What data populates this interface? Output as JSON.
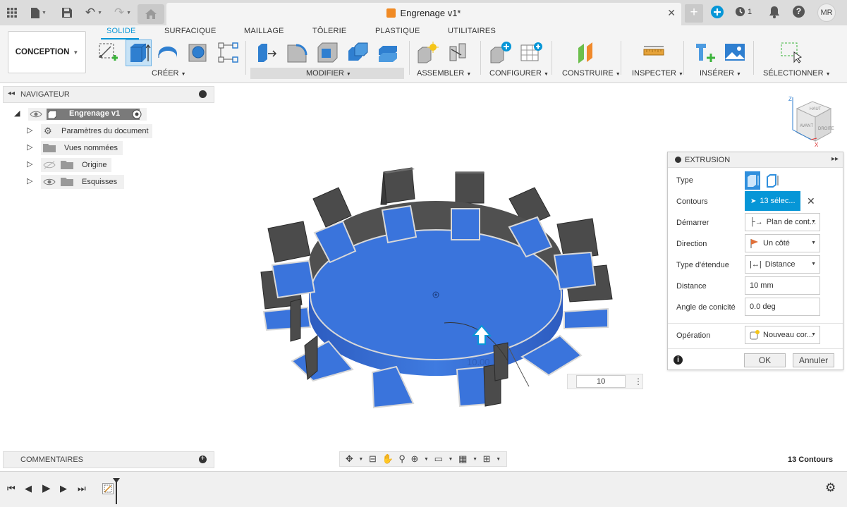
{
  "titlebar": {
    "document_title": "Engrenage v1*",
    "history_count": "1",
    "user_initials": "MR"
  },
  "workspace": {
    "label": "CONCEPTION"
  },
  "tabs": [
    "SOLIDE",
    "SURFACIQUE",
    "MAILLAGE",
    "TÔLERIE",
    "PLASTIQUE",
    "UTILITAIRES"
  ],
  "groups": {
    "creer": "CRÉER",
    "modifier": "MODIFIER",
    "assembler": "ASSEMBLER",
    "configurer": "CONFIGURER",
    "construire": "CONSTRUIRE",
    "inspecter": "INSPECTER",
    "inserer": "INSÉRER",
    "selectionner": "SÉLECTIONNER"
  },
  "navigator": {
    "title": "NAVIGATEUR",
    "root": "Engrenage v1",
    "items": [
      "Paramètres du document",
      "Vues nommées",
      "Origine",
      "Esquisses"
    ]
  },
  "viewcube": {
    "top_label": "HAUT",
    "front_label": "AVANT",
    "right_label": "DROITE"
  },
  "extrusion": {
    "title": "EXTRUSION",
    "labels": {
      "type": "Type",
      "contours": "Contours",
      "demarrer": "Démarrer",
      "direction": "Direction",
      "type_etendue": "Type d'étendue",
      "distance": "Distance",
      "angle": "Angle de conicité",
      "operation": "Opération"
    },
    "values": {
      "contours": "13 sélec...",
      "demarrer": "Plan de cont...",
      "direction": "Un côté",
      "type_etendue": "Distance",
      "distance": "10 mm",
      "angle": "0.0 deg",
      "operation": "Nouveau cor..."
    },
    "ok": "OK",
    "cancel": "Annuler"
  },
  "manipulator": {
    "value": "10",
    "ghost": "10.00"
  },
  "comments": {
    "title": "COMMENTAIRES"
  },
  "status": {
    "selection": "13 Contours"
  },
  "colors": {
    "accent": "#0696d7",
    "selection_blue": "#2e6ed6",
    "gear_gray": "#4a4a4a",
    "brand_orange": "#f08a24"
  }
}
